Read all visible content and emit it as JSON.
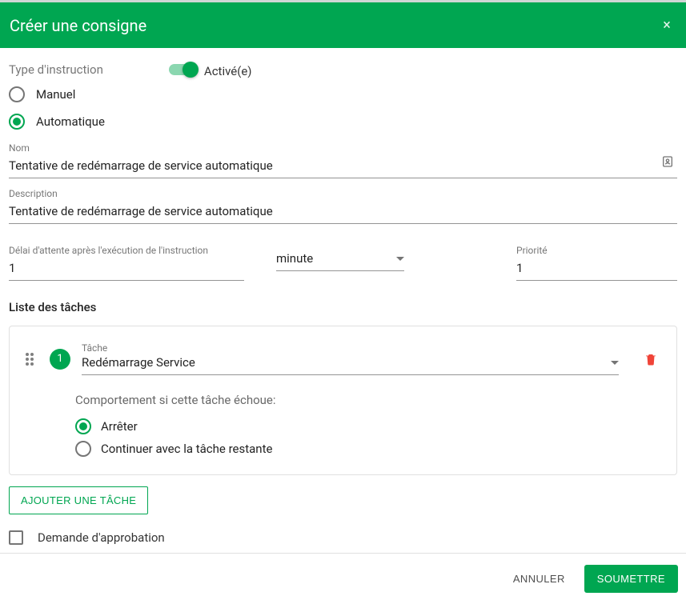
{
  "header": {
    "title": "Créer une consigne"
  },
  "type": {
    "label": "Type d'instruction",
    "options": {
      "manual": "Manuel",
      "automatic": "Automatique"
    },
    "selected": "automatic"
  },
  "activation": {
    "label": "Activé(e)",
    "enabled": true
  },
  "name": {
    "label": "Nom",
    "value": "Tentative de redémarrage de service automatique"
  },
  "description": {
    "label": "Description",
    "value": "Tentative de redémarrage de service automatique"
  },
  "delay": {
    "label": "Délai d'attente après l'exécution de l'instruction",
    "value": "1",
    "unit": "minute"
  },
  "priority": {
    "label": "Priorité",
    "value": "1"
  },
  "tasks": {
    "section_label": "Liste des tâches",
    "task_field_label": "Tâche",
    "items": [
      {
        "index": "1",
        "name": "Redémarrage Service",
        "fail_behavior": "stop"
      }
    ],
    "behavior_label": "Comportement si cette tâche échoue:",
    "behavior_options": {
      "stop": "Arrêter",
      "continue": "Continuer avec la tâche restante"
    },
    "add_label": "AJOUTER UNE TÂCHE"
  },
  "approval": {
    "label": "Demande d'approbation",
    "checked": false
  },
  "footer": {
    "cancel": "ANNULER",
    "submit": "SOUMETTRE"
  }
}
